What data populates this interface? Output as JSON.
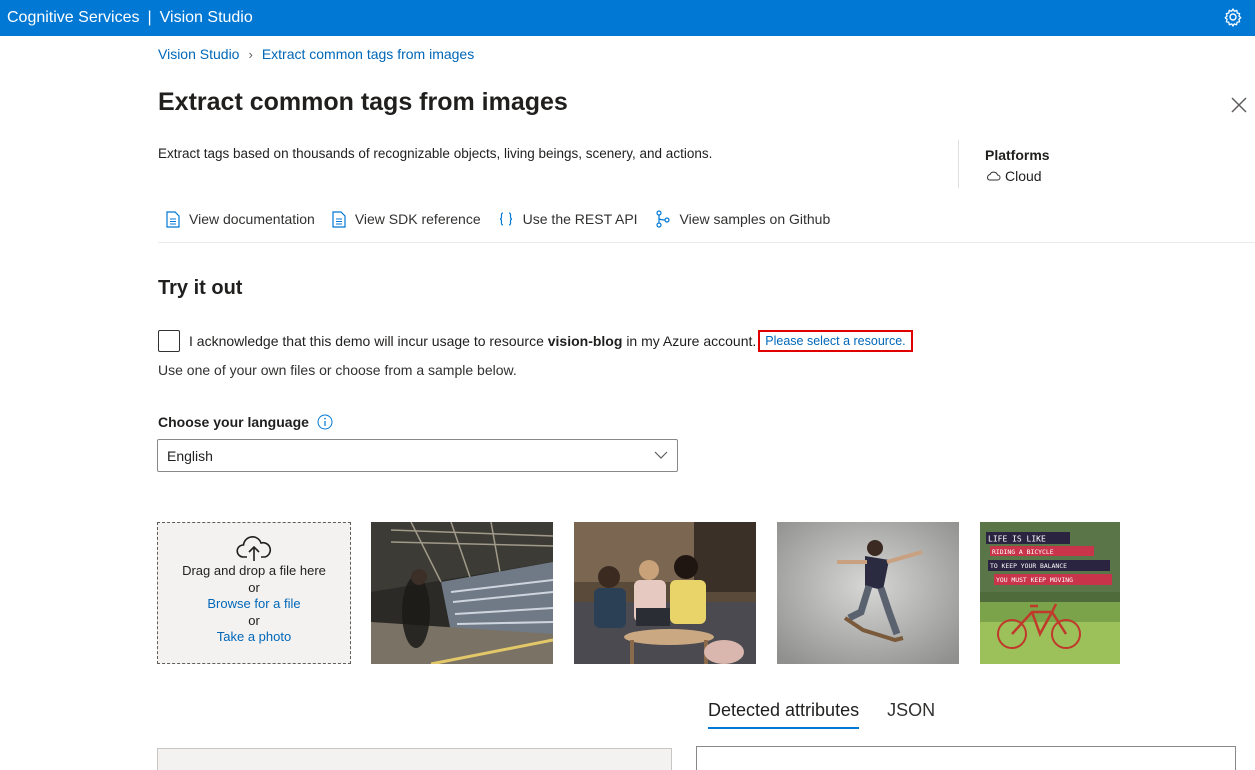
{
  "topbar": {
    "service": "Cognitive Services",
    "separator": "|",
    "app": "Vision Studio"
  },
  "breadcrumb": {
    "home": "Vision Studio",
    "current": "Extract common tags from images"
  },
  "page": {
    "title": "Extract common tags from images",
    "description": "Extract tags based on thousands of recognizable objects, living beings, scenery, and actions."
  },
  "platforms": {
    "title": "Platforms",
    "value": "Cloud"
  },
  "links": {
    "docs": "View documentation",
    "sdk": "View SDK reference",
    "rest": "Use the REST API",
    "github": "View samples on Github"
  },
  "try": {
    "title": "Try it out",
    "ack_prefix": "I acknowledge that this demo will incur usage to resource",
    "resource": "vision-blog",
    "ack_suffix": "in my Azure account.",
    "select_resource": "Please select a resource.",
    "use_files": "Use one of your own files or choose from a sample below."
  },
  "language": {
    "label": "Choose your language",
    "selected": "English"
  },
  "dropzone": {
    "drag": "Drag and drop a file here",
    "or1": "or",
    "browse": "Browse for a file",
    "or2": "or",
    "photo": "Take a photo"
  },
  "sample_sign": {
    "line1": "LIFE IS LIKE",
    "line2": "RIDING A BICYCLE",
    "line3": "TO KEEP YOUR BALANCE",
    "line4": "YOU MUST KEEP MOVING"
  },
  "tabs": {
    "detected": "Detected attributes",
    "json": "JSON"
  },
  "colors": {
    "brand": "#0078d4",
    "link": "#0067b8",
    "highlight": "#e00000"
  }
}
